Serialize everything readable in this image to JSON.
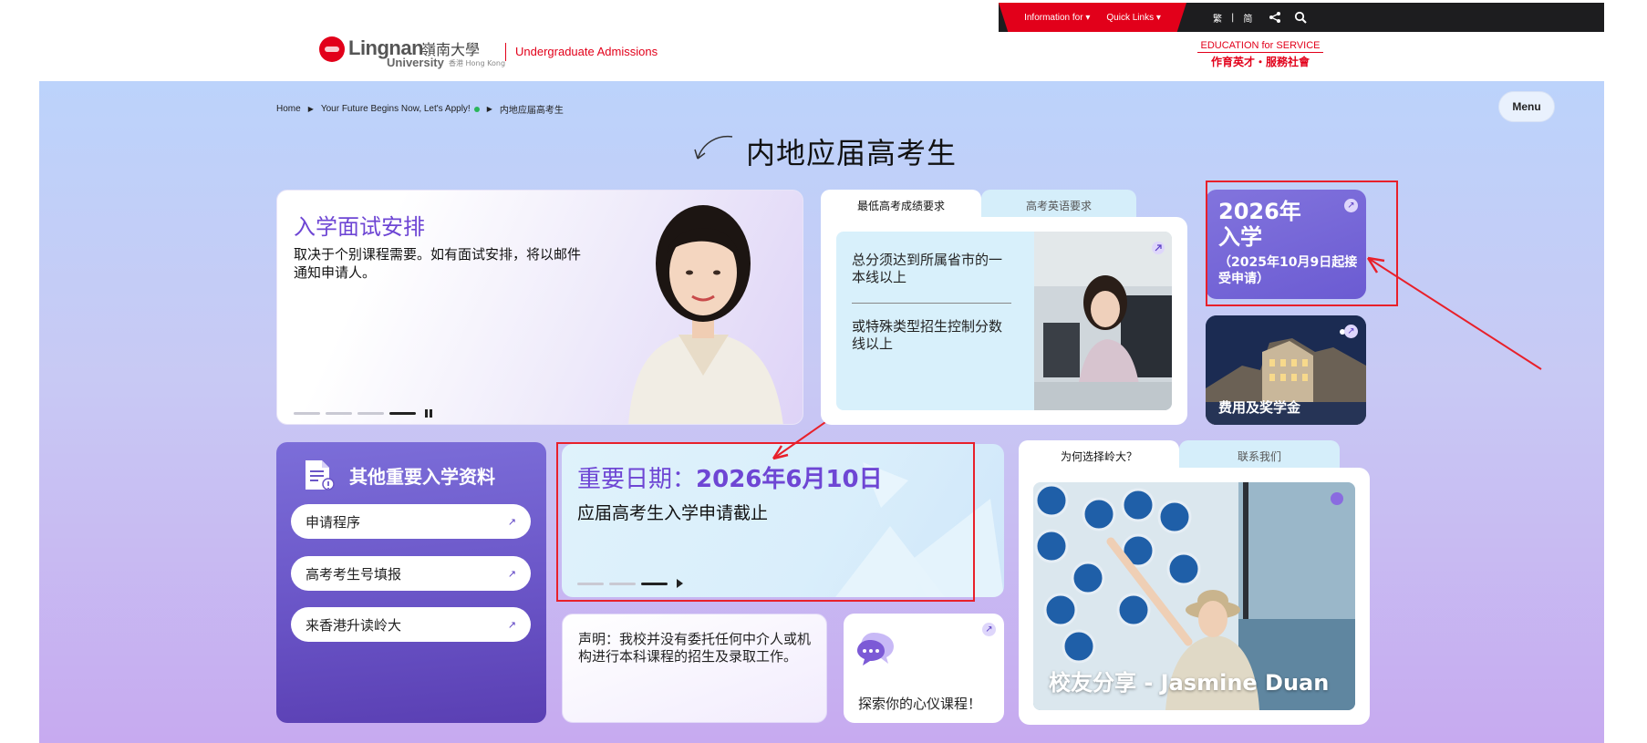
{
  "topbar": {
    "information_for": "Information for",
    "quick_links": "Quick Links",
    "lang_trad": "繁",
    "lang_sep": "|",
    "lang_simp": "简"
  },
  "header": {
    "logo_name": "Lingnan",
    "logo_cn": "嶺南大學",
    "logo_sub": "University",
    "logo_sub2": "香港 Hong Kong",
    "subtitle": "Undergraduate Admissions",
    "motto_en": "EDUCATION for SERVICE",
    "motto_cn": "作育英才・服務社會"
  },
  "breadcrumb": {
    "home": "Home",
    "level2": "Your Future Begins Now, Let's Apply!",
    "current": "内地应届高考生"
  },
  "menu_label": "Menu",
  "page_title": "内地应届高考生",
  "interview": {
    "title": "入学面试安排",
    "text": "取决于个别课程需要。如有面试安排，将以邮件通知申请人。"
  },
  "scores": {
    "tab_active": "最低高考成绩要求",
    "tab_inactive": "高考英语要求",
    "text1": "总分须达到所属省市的一本线以上",
    "text2": "或特殊类型招生控制分数线以上"
  },
  "admission": {
    "year": "2026年",
    "year2": "入学",
    "sub": "（2025年10月9日起接受申请）"
  },
  "fees": {
    "title": "费用及奖学金"
  },
  "info": {
    "title": "其他重要入学资料",
    "links": [
      "申请程序",
      "高考考生号填报",
      "来香港升读岭大"
    ]
  },
  "date": {
    "prefix": "重要日期：",
    "date": "2026年6月10日",
    "text": "应届高考生入学申请截止"
  },
  "notice": {
    "text": "声明：我校并没有委托任何中介人或机构进行本科课程的招生及录取工作。"
  },
  "courses": {
    "text": "探索你的心仪课程！"
  },
  "why": {
    "tab_active": "为何选择岭大？",
    "tab_inactive": "联系我们",
    "alumni_title": "校友分享 - Jasmine Duan"
  },
  "icons": {
    "external": "external-link-icon",
    "search": "search-icon",
    "share": "share-icon",
    "document": "document-icon",
    "chat": "chat-icon"
  },
  "colors": {
    "brand_red": "#e2001a",
    "accent_purple": "#6e46d4",
    "annotation_red": "#e8202a"
  }
}
